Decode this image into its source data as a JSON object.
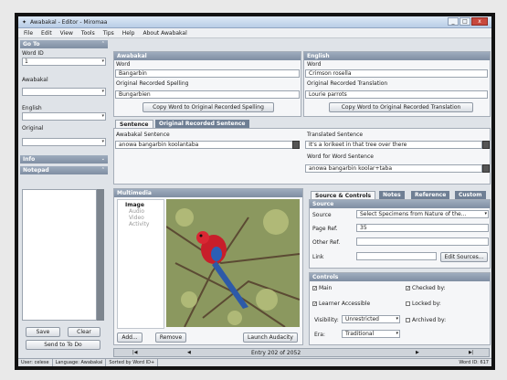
{
  "window": {
    "title": "Awabakal - Editor - Miromaa",
    "min": "_",
    "max": "□",
    "close": "x"
  },
  "menu": [
    "File",
    "Edit",
    "View",
    "Tools",
    "Tips",
    "Help",
    "About Awabakal"
  ],
  "goto": {
    "header": "Go To",
    "word_id_label": "Word ID",
    "awabakal_label": "Awabakal",
    "english_label": "English",
    "original_label": "Original",
    "word_id_value": "1",
    "info_header": "Info",
    "notepad_header": "Notepad",
    "save": "Save",
    "clear": "Clear",
    "send_to_do": "Send to To Do"
  },
  "awabakal": {
    "header": "Awabakal",
    "word_label": "Word",
    "word": "Bangarbin",
    "spelling_label": "Original Recorded Spelling",
    "spelling": "Bungarbien",
    "copy_btn": "Copy Word to Original Recorded Spelling"
  },
  "english": {
    "header": "English",
    "word_label": "Word",
    "word": "Crimson rosella",
    "translation_label": "Original Recorded Translation",
    "translation": "Lourie parrots",
    "copy_btn": "Copy Word to Original Recorded Translation"
  },
  "sentence": {
    "tab1": "Sentence",
    "tab2": "Original Recorded Sentence",
    "awabakal_label": "Awabakal Sentence",
    "awabakal": "anowa bangarbin koolantaba",
    "translated_label": "Translated Sentence",
    "translated": "It's a lorikeet in that tree over there",
    "wfw_label": "Word for Word Sentence",
    "wfw": "anowa bangarbin koolar+taba"
  },
  "multimedia": {
    "header": "Multimedia",
    "tree": [
      "Image",
      "Audio",
      "Video",
      "Activity"
    ],
    "add": "Add...",
    "remove": "Remove",
    "launch": "Launch Audacity"
  },
  "source_tabs": [
    "Source & Controls",
    "Notes",
    "Reference",
    "Custom"
  ],
  "source": {
    "header": "Source",
    "source_label": "Source",
    "source_value": "Select Specimens from Nature of the...",
    "page_label": "Page Ref.",
    "page_value": "35",
    "other_label": "Other Ref.",
    "link_label": "Link",
    "edit_btn": "Edit Sources..."
  },
  "controls": {
    "header": "Controls",
    "main": "Main",
    "learner": "Learner Accessible",
    "checked": "Checked by:",
    "locked": "Locked by:",
    "archived": "Archived by:",
    "visibility_label": "Visibility:",
    "visibility": "Unrestricted",
    "era_label": "Era:",
    "era": "Traditional"
  },
  "nav": {
    "entry": "Entry 202 of 2052"
  },
  "status": [
    "User: celese",
    "Language: Awabakal",
    "Sorted by Word ID+",
    "Word ID: 617"
  ]
}
